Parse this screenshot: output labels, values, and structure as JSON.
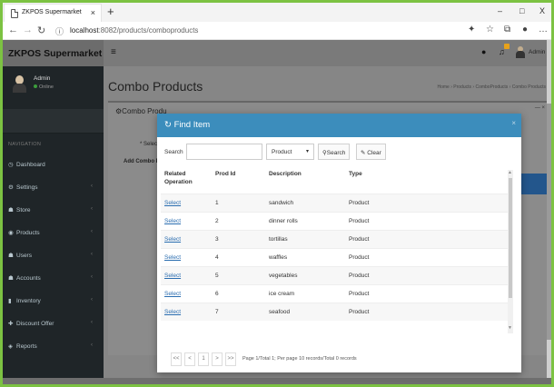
{
  "browser": {
    "tab_title": "ZKPOS Supermarket",
    "tab_close": "×",
    "new_tab": "+",
    "url_host": "localhost",
    "url_path": ":8082/products/comboproducts",
    "minimize": "–",
    "maximize": "□",
    "close": "X"
  },
  "app": {
    "brand": "ZKPOS Supermarket",
    "user": {
      "name": "Admin",
      "status": "Online"
    },
    "nav_header": "NAVIGATION",
    "menu": [
      {
        "icon": "tachometer-icon",
        "glyph": "◷",
        "label": "Dashboard",
        "has_children": false
      },
      {
        "icon": "gear-icon",
        "glyph": "⚙",
        "label": "Settings",
        "has_children": true
      },
      {
        "icon": "store-icon",
        "glyph": "☗",
        "label": "Store",
        "has_children": true
      },
      {
        "icon": "products-icon",
        "glyph": "◉",
        "label": "Products",
        "has_children": true
      },
      {
        "icon": "users-icon",
        "glyph": "☗",
        "label": "Users",
        "has_children": true
      },
      {
        "icon": "accounts-icon",
        "glyph": "☗",
        "label": "Accounts",
        "has_children": true
      },
      {
        "icon": "inventory-icon",
        "glyph": "▮",
        "label": "Inventory",
        "has_children": true
      },
      {
        "icon": "discount-icon",
        "glyph": "✚",
        "label": "Discount Offer",
        "has_children": true
      },
      {
        "icon": "reports-icon",
        "glyph": "◈",
        "label": "Reports",
        "has_children": true
      }
    ],
    "topbar": {
      "admin_label": "Admin"
    },
    "page_title": "Combo Products",
    "breadcrumb": "Home  ›  Products  ›  ComboProducts  ›  Combo Products",
    "box": {
      "title": "Combo Produ",
      "select_label": "* Select P",
      "add_label": "Add Combo Pr",
      "tools": "— ×"
    }
  },
  "modal": {
    "title": "Find Item",
    "close": "×",
    "search_label": "Search",
    "search_value": "",
    "type_selected": "Product",
    "search_button": "Search",
    "clear_button": "Clear",
    "columns": [
      "Related Operation",
      "Prod Id",
      "Description",
      "Type"
    ],
    "rows": [
      {
        "action": "Select",
        "id": "1",
        "description": "sandwich",
        "type": "Product"
      },
      {
        "action": "Select",
        "id": "2",
        "description": "dinner rolls",
        "type": "Product"
      },
      {
        "action": "Select",
        "id": "3",
        "description": "tortillas",
        "type": "Product"
      },
      {
        "action": "Select",
        "id": "4",
        "description": "waffles",
        "type": "Product"
      },
      {
        "action": "Select",
        "id": "5",
        "description": "vegetables",
        "type": "Product"
      },
      {
        "action": "Select",
        "id": "6",
        "description": "ice cream",
        "type": "Product"
      },
      {
        "action": "Select",
        "id": "7",
        "description": "seafood",
        "type": "Product"
      }
    ],
    "pager": {
      "first": "<<",
      "prev": "<",
      "page": "1",
      "next": ">",
      "last": ">>",
      "info": "Page 1/Total 1; Per page 10 records/Total 0 records"
    }
  }
}
